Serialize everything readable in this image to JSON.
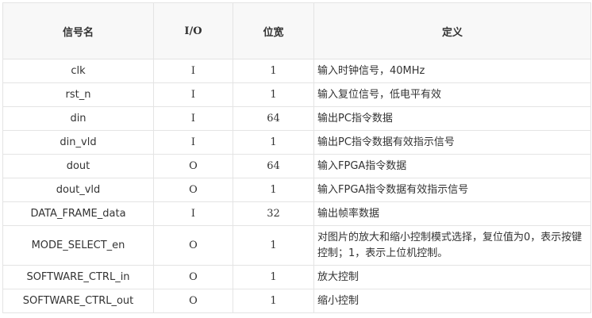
{
  "table": {
    "headers": {
      "name": "信号名",
      "io": "I/O",
      "width": "位宽",
      "definition": "定义"
    },
    "rows": [
      {
        "name": "clk",
        "io": "I",
        "width": "1",
        "definition": "输入时钟信号，40MHz"
      },
      {
        "name": "rst_n",
        "io": "I",
        "width": "1",
        "definition": "输入复位信号，低电平有效"
      },
      {
        "name": "din",
        "io": "I",
        "width": "64",
        "definition": "输出PC指令数据"
      },
      {
        "name": "din_vld",
        "io": "I",
        "width": "1",
        "definition": "输出PC指令数据有效指示信号"
      },
      {
        "name": "dout",
        "io": "O",
        "width": "64",
        "definition": "输入FPGA指令数据"
      },
      {
        "name": "dout_vld",
        "io": "O",
        "width": "1",
        "definition": "输入FPGA指令数据有效指示信号"
      },
      {
        "name": "DATA_FRAME_data",
        "io": "I",
        "width": "32",
        "definition": "输出帧率数据"
      },
      {
        "name": "MODE_SELECT_en",
        "io": "O",
        "width": "1",
        "definition": "对图片的放大和缩小控制模式选择，复位值为0，表示按键控制；1，表示上位机控制。"
      },
      {
        "name": "SOFTWARE_CTRL_in",
        "io": "O",
        "width": "1",
        "definition": "放大控制"
      },
      {
        "name": "SOFTWARE_CTRL_out",
        "io": "O",
        "width": "1",
        "definition": "缩小控制"
      }
    ]
  }
}
